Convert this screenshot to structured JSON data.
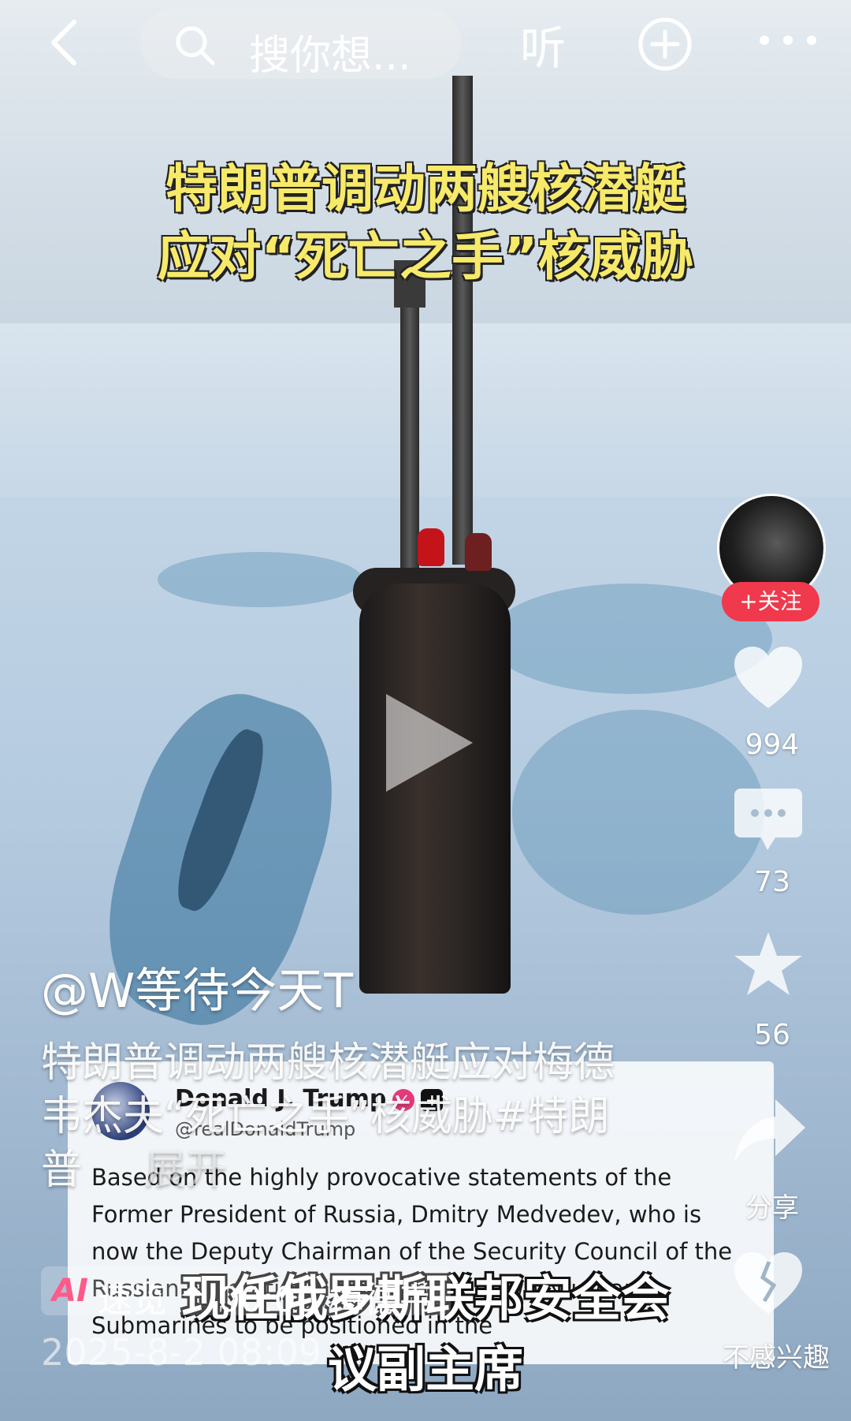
{
  "topbar": {
    "search_placeholder": "搜你想...",
    "listen_label": "听"
  },
  "video": {
    "headline_line1": "特朗普调动两艘核潜艇",
    "headline_line2": "应对“死亡之手”核威胁",
    "subtitle_line1": "现任俄罗斯联邦安全会",
    "subtitle_line2": "议副主席",
    "embedded_post": {
      "name": "Donald J. Trump",
      "handle": "@realDonaldTrump",
      "body": "Based on the highly provocative statements of the Former President of Russia, Dmitry Medvedev, who is now the Deputy Chairman of the Security Council of the Russian Federation, I have ordered two Nuclear Submarines to be positioned in the"
    }
  },
  "rail": {
    "follow_label": "+关注",
    "likes": "994",
    "comments": "73",
    "favorites": "56",
    "share_label": "分享",
    "dislike_label": "不感兴趣"
  },
  "post": {
    "author": "@W等待今天T",
    "description": "特朗普调动两艘核潜艇应对梅德韦杰夫“死亡之手”核威胁#特朗普",
    "expand_label": "展开",
    "ai_logo": "AI",
    "ai_summary": "速览 ^ 00:00 梅德韦",
    "date": "2025-8-2 08:09"
  },
  "colors": {
    "headline": "#f7ea6a",
    "follow": "#f0394c"
  }
}
